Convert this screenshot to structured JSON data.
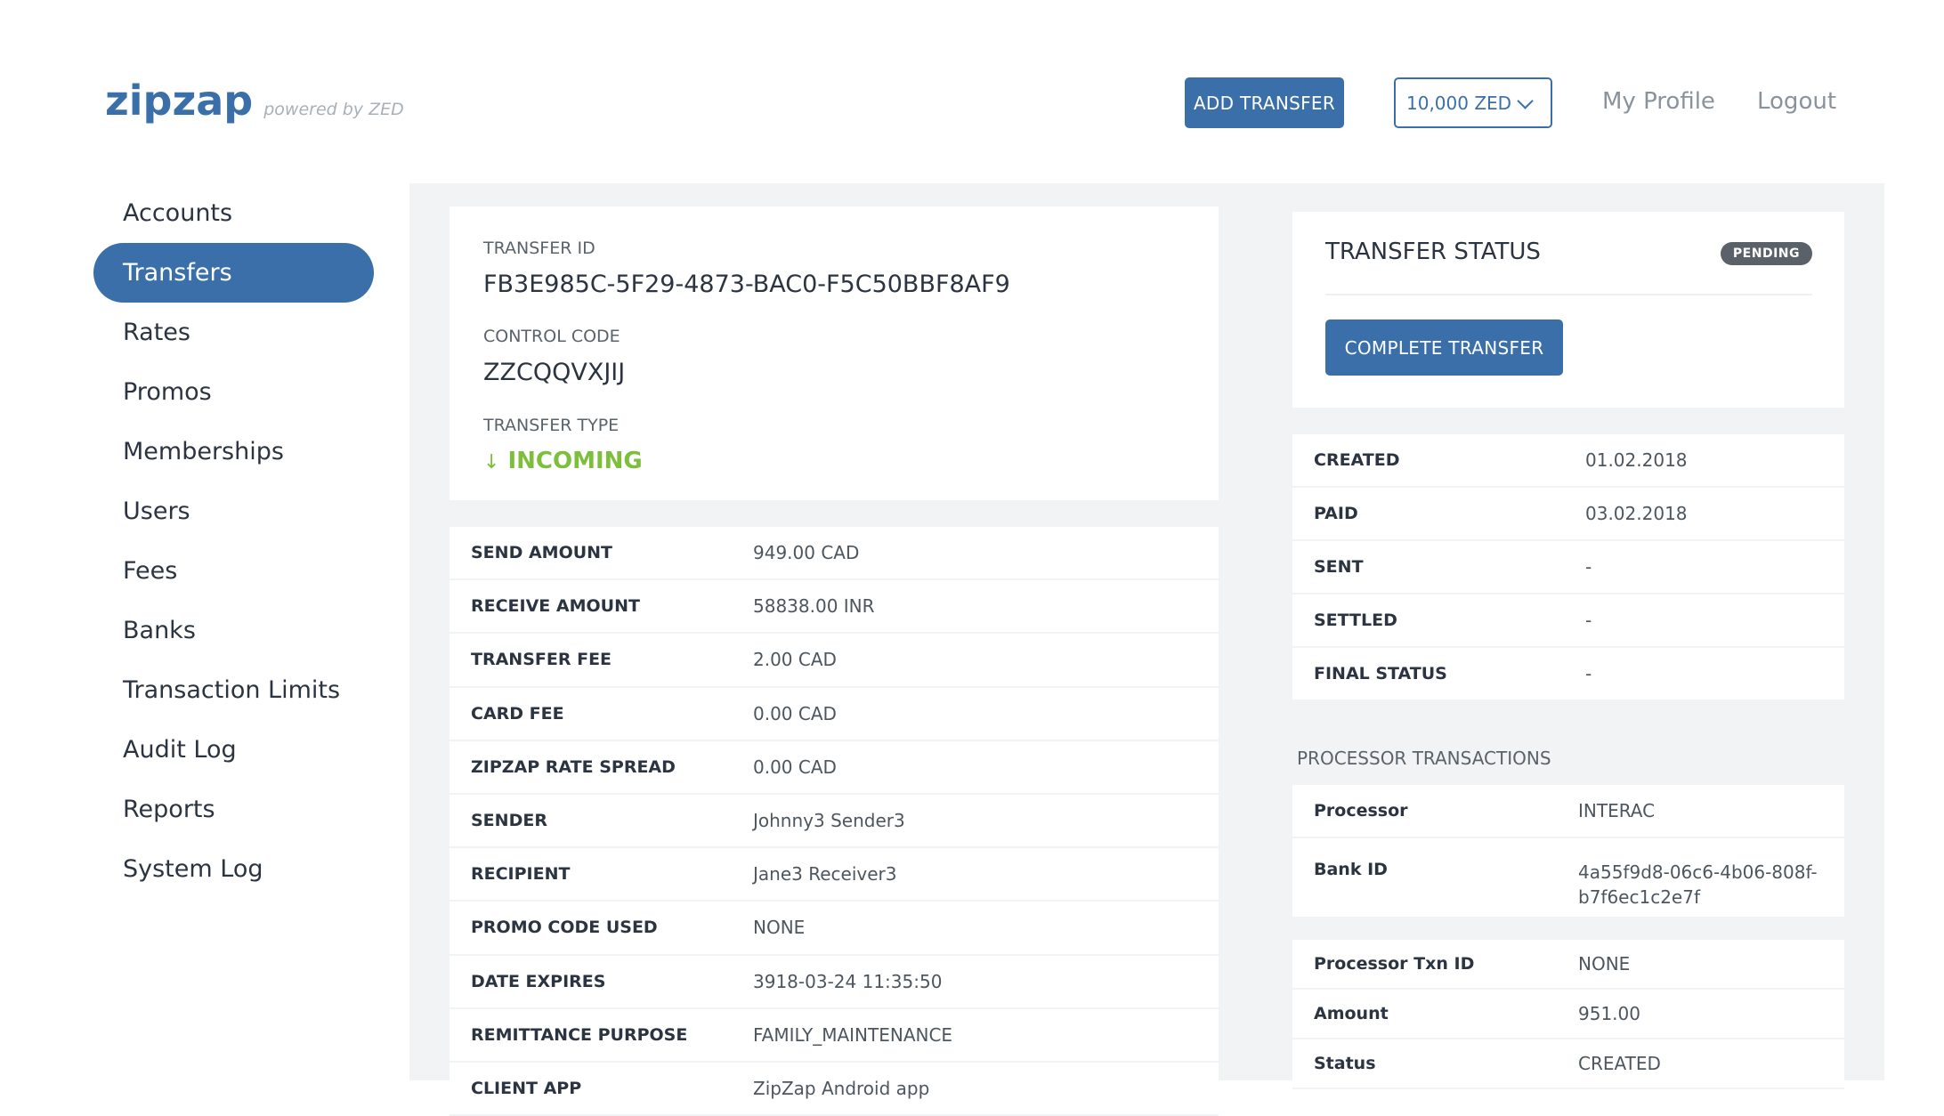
{
  "header": {
    "logo": "zipzap",
    "logo_tagline": "powered by ZED",
    "add_transfer": "ADD TRANSFER",
    "balance_select": "10,000 ZED",
    "my_profile": "My Profile",
    "logout": "Logout"
  },
  "sidebar": {
    "items": [
      {
        "label": "Accounts"
      },
      {
        "label": "Transfers",
        "active": true
      },
      {
        "label": "Rates"
      },
      {
        "label": "Promos"
      },
      {
        "label": "Memberships"
      },
      {
        "label": "Users"
      },
      {
        "label": "Fees"
      },
      {
        "label": "Banks"
      },
      {
        "label": "Transaction Limits"
      },
      {
        "label": "Audit Log"
      },
      {
        "label": "Reports"
      },
      {
        "label": "System Log"
      }
    ]
  },
  "transfer": {
    "id_label": "TRANSFER ID",
    "id_value": "FB3E985C-5F29-4873-BAC0-F5C50BBF8AF9",
    "control_label": "CONTROL CODE",
    "control_value": "ZZCQQVXJIJ",
    "type_label": "TRANSFER TYPE",
    "type_arrow": "↓",
    "type_value": "INCOMING",
    "type_color": "#7bbf3a"
  },
  "details": [
    {
      "key": "SEND AMOUNT",
      "value": "949.00 CAD"
    },
    {
      "key": "RECEIVE AMOUNT",
      "value": "58838.00 INR"
    },
    {
      "key": "TRANSFER FEE",
      "value": "2.00 CAD"
    },
    {
      "key": "CARD FEE",
      "value": "0.00 CAD"
    },
    {
      "key": "ZIPZAP RATE SPREAD",
      "value": "0.00 CAD"
    },
    {
      "key": "SENDER",
      "value": "Johnny3 Sender3"
    },
    {
      "key": "RECIPIENT",
      "value": "Jane3 Receiver3"
    },
    {
      "key": "PROMO CODE USED",
      "value": "NONE"
    },
    {
      "key": "DATE EXPIRES",
      "value": "3918-03-24 11:35:50"
    },
    {
      "key": "REMITTANCE PURPOSE",
      "value": "FAMILY_MAINTENANCE"
    },
    {
      "key": "CLIENT APP",
      "value": "ZipZap Android app"
    }
  ],
  "status": {
    "title": "TRANSFER STATUS",
    "badge": "PENDING",
    "complete_button": "COMPLETE TRANSFER"
  },
  "dates": [
    {
      "key": "CREATED",
      "value": "01.02.2018"
    },
    {
      "key": "PAID",
      "value": "03.02.2018"
    },
    {
      "key": "SENT",
      "value": "-"
    },
    {
      "key": "SETTLED",
      "value": "-"
    },
    {
      "key": "FINAL STATUS",
      "value": "-"
    }
  ],
  "processor": {
    "section_title": "PROCESSOR TRANSACTIONS",
    "rows": [
      {
        "key": "Processor",
        "value": "INTERAC"
      },
      {
        "key": "Bank ID",
        "value": "4a55f9d8-06c6-4b06-808f-b7f6ec1c2e7f"
      }
    ],
    "txn_rows": [
      {
        "key": "Processor Txn ID",
        "value": "NONE"
      },
      {
        "key": "Amount",
        "value": "951.00"
      },
      {
        "key": "Status",
        "value": "CREATED"
      }
    ]
  },
  "colors": {
    "brand": "#3a6fa9",
    "incoming": "#7bbf3a",
    "badge_bg": "#5a6168"
  }
}
